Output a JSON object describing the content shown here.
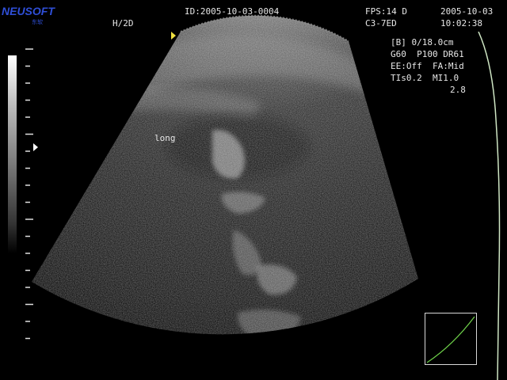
{
  "header": {
    "patient_id": "ID:2005-10-03-0004",
    "mode": "H/2D",
    "fps": "FPS:14 D",
    "probe": "C3-7ED",
    "date": "2005-10-03",
    "time": "10:02:38"
  },
  "logo": {
    "brand": "NEUSOFT",
    "sub": "东软"
  },
  "params": {
    "line1": "[B] 0/18.0cm",
    "line2": "G60  P100 DR61",
    "line3": "EE:Off  FA:Mid",
    "line4": "TIs0.2  MI1.0",
    "line5": "2.8"
  },
  "annotation": {
    "label": "long"
  },
  "colors": {
    "logo": "#2f4fd8",
    "focus_marker": "#f0e040",
    "tgc_curve": "#cfe6c4",
    "gamma_curve": "#6fd24a"
  }
}
